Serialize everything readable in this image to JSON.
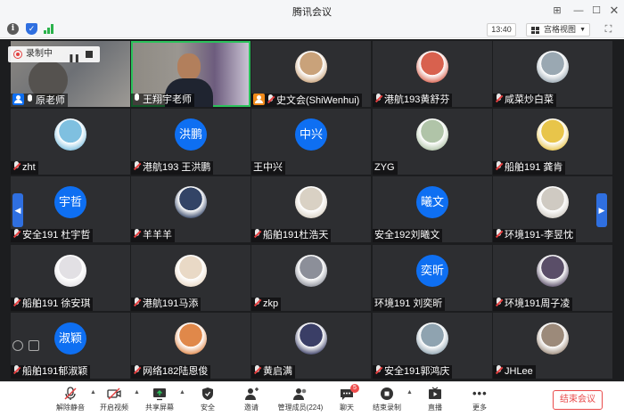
{
  "window": {
    "title": "腾讯会议"
  },
  "infobar": {
    "time": "13:40",
    "view_mode": "宫格视图"
  },
  "recording": {
    "status": "录制中"
  },
  "participants": [
    {
      "name": "原老师",
      "type": "video",
      "mic": "on",
      "badge": "host"
    },
    {
      "name": "王翔宇老师",
      "type": "video",
      "mic": "on",
      "active": true
    },
    {
      "name": "史文会(ShiWenhui)",
      "type": "image",
      "mic": "muted",
      "badge": "cohost"
    },
    {
      "name": "港航193黄舒芬",
      "type": "image",
      "mic": "muted"
    },
    {
      "name": "咸菜炒白菜",
      "type": "image",
      "mic": "muted"
    },
    {
      "name": "zht",
      "type": "image",
      "mic": "muted"
    },
    {
      "name": "港航193 王洪鹏",
      "type": "text",
      "avatar_text": "洪鹏",
      "mic": "muted"
    },
    {
      "name": "王中兴",
      "type": "text",
      "avatar_text": "中兴",
      "mic": "none"
    },
    {
      "name": "ZYG",
      "type": "image",
      "mic": "none"
    },
    {
      "name": "船舶191 龚肯",
      "type": "image",
      "mic": "muted"
    },
    {
      "name": "安全191 杜宇哲",
      "type": "text",
      "avatar_text": "宇哲",
      "mic": "muted"
    },
    {
      "name": "羊羊羊",
      "type": "image",
      "mic": "muted"
    },
    {
      "name": "船舶191杜浩天",
      "type": "image",
      "mic": "muted"
    },
    {
      "name": "安全192刘曦文",
      "type": "text",
      "avatar_text": "曦文",
      "mic": "none"
    },
    {
      "name": "环境191-李昱忱",
      "type": "image",
      "mic": "muted"
    },
    {
      "name": "船舶191 徐安琪",
      "type": "image",
      "mic": "muted"
    },
    {
      "name": "港航191马添",
      "type": "image",
      "mic": "muted"
    },
    {
      "name": "zkp",
      "type": "image",
      "mic": "muted"
    },
    {
      "name": "环境191 刘奕昕",
      "type": "text",
      "avatar_text": "奕昕",
      "mic": "none"
    },
    {
      "name": "环境191周子凌",
      "type": "image",
      "mic": "muted"
    },
    {
      "name": "船舶191郁淑颖",
      "type": "text",
      "avatar_text": "淑颖",
      "mic": "muted"
    },
    {
      "name": "网络182陆恩俊",
      "type": "image",
      "mic": "muted"
    },
    {
      "name": "黄启满",
      "type": "image",
      "mic": "muted"
    },
    {
      "name": "安全191郭鸿庆",
      "type": "image",
      "mic": "muted"
    },
    {
      "name": "JHLee",
      "type": "image",
      "mic": "muted"
    }
  ],
  "avatar_colors": [
    "#c9a27a",
    "#d8614e",
    "#9aa8b2",
    "#7fc0e0",
    "#b0c4a8",
    "#e8c54a",
    "#334466",
    "#d9d1c4",
    "#cfcac2",
    "#e2e0e4",
    "#e9d9c6",
    "#8c8f99",
    "#5a4e68",
    "#e0884a",
    "#3a3e66",
    "#8fa3b0",
    "#9c8a7a",
    "#f2a0a0",
    "#2d4d8a",
    "#f3f3f3"
  ],
  "toolbar": {
    "mute": "解除静音",
    "video": "开启视频",
    "share": "共享屏幕",
    "security": "安全",
    "invite": "邀请",
    "members": "管理成员(224)",
    "chat": "聊天",
    "chat_badge": "5",
    "record": "结束录制",
    "live": "直播",
    "more": "更多",
    "end": "结束会议"
  }
}
